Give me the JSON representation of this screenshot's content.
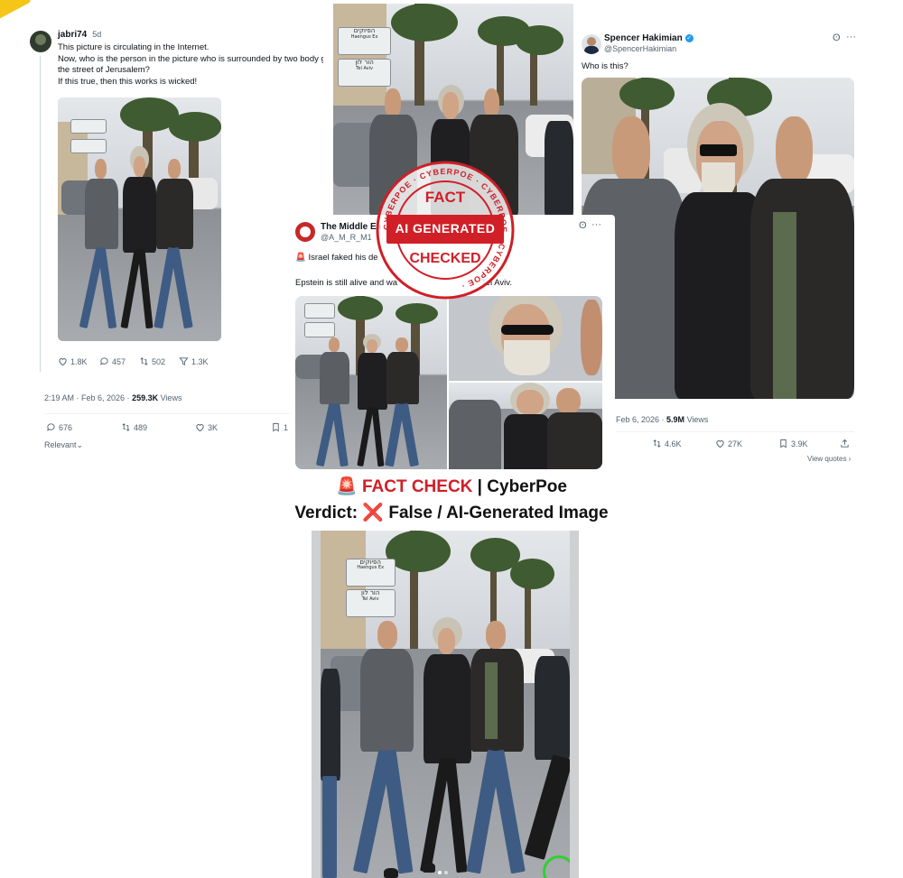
{
  "tweet1": {
    "user": "jabri74",
    "age": "5d",
    "lines": [
      "This picture is circulating in the Internet.",
      "Now, who is the person in the picture who is surrounded by two body g",
      "the street of Jerusalem?",
      "If this true, then this works is wicked!"
    ],
    "stats": {
      "likes": "1.8K",
      "replies": "457",
      "reposts": "502",
      "views": "1.3K"
    },
    "meta": "2:19 AM · Feb 6, 2026 · ",
    "views_count": "259.3K",
    "views_label": " Views",
    "actions": {
      "replies": "676",
      "reposts": "489",
      "likes": "3K",
      "bookmark": "1"
    },
    "sort": "Relevant"
  },
  "tweet2": {
    "user": "Spencer Hakimian",
    "handle": "@SpencerHakimian",
    "text": "Who is this?",
    "meta": "Feb 6, 2026 · ",
    "views_count": "5.9M",
    "views_label": " Views",
    "actions": {
      "reposts": "4.6K",
      "likes": "27K",
      "bookmarks": "3.9K"
    },
    "view_quotes": "View quotes ›"
  },
  "tweet3": {
    "user": "The Middle Ea",
    "handle": "@A_M_R_M1",
    "line1_icon": "🚨",
    "line1": "Israel faked his de",
    "line2a": "Epstein is still alive and wa",
    "line2b": "Tel Aviv."
  },
  "stamp": {
    "top": "FACT",
    "middle": "AI GENERATED",
    "bottom": "CHECKED",
    "ring": "CYBERPOE · CYBERPOE · CYBERPOE · CYBERPOE ·"
  },
  "headline": {
    "icon": "🚨",
    "fact": "FACT CHECK",
    "sep": " | ",
    "brand": "CyberPoe",
    "verdict_label": "Verdict: ",
    "verdict_icon": "❌",
    "verdict": "False / AI-Generated Image"
  },
  "sign": {
    "line1": "הפיוקים",
    "line2": "Haengus Ex",
    "line3": "הור לון",
    "line4": "Tel Aviv"
  },
  "colors": {
    "red": "#d01f27",
    "green_circle": "#2fd12f",
    "verified": "#1d9bf0",
    "text": "#0f1419",
    "muted": "#536471"
  }
}
